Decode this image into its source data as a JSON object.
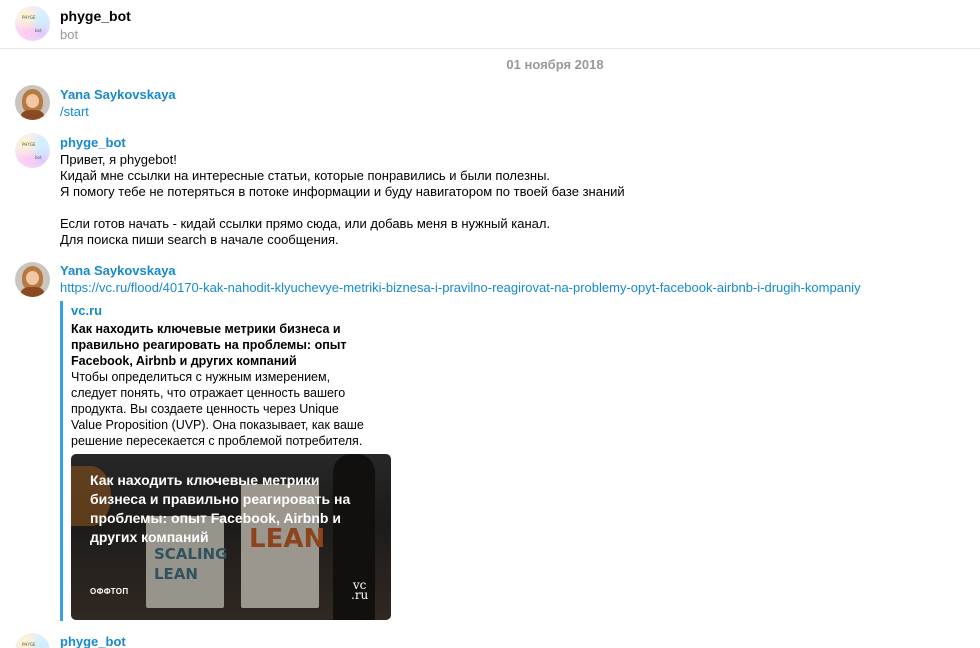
{
  "header": {
    "title": "phyge_bot",
    "subtitle": "bot",
    "avatar_text_top": "PHYGE",
    "avatar_text_bottom": "bot"
  },
  "date_separator": "01 ноября 2018",
  "messages": [
    {
      "author": "Yana Saykovskaya",
      "avatar": "user-photo",
      "text": "/start"
    },
    {
      "author": "phyge_bot",
      "avatar": "bot-logo",
      "lines": [
        "Привет, я phygebot!",
        "Кидай мне ссылки на интересные статьи, которые понравились и были полезны.",
        "Я помогу тебе не потеряться в потоке информации и буду навигатором по твоей базе знаний",
        "",
        "Если готов начать - кидай ссылки прямо сюда, или добавь меня в нужный канал.",
        "Для поиска пиши search в начале сообщения."
      ]
    },
    {
      "author": "Yana Saykovskaya",
      "avatar": "user-photo",
      "link": "https://vc.ru/flood/40170-kak-nahodit-klyuchevye-metriki-biznesa-i-pravilno-reagirovat-na-problemy-opyt-facebook-airbnb-i-drugih-kompaniy",
      "preview": {
        "site": "vc.ru",
        "title": "Как находить ключевые метрики бизнеса и\nправильно реагировать на проблемы: опыт\nFacebook, Airbnb и других компаний",
        "description": "Чтобы определиться с нужным измерением,\nследует понять, что отражает ценность вашего\nпродукта. Вы создаете ценность через Unique\nValue Proposition (UVP). Она показывает, как ваше\nрешение пересекается с проблемой потребителя.",
        "image": {
          "title": "Как находить ключевые метрики\nбизнеса и правильно реагировать на\nпроблемы: опыт Facebook, Airbnb и\nдругих компаний",
          "tag": "ОФФТОП",
          "logo_top": "vc",
          "logo_bottom": ".ru",
          "book1": "SCALING\nLEAN",
          "book2": "LEAN"
        }
      }
    },
    {
      "author": "phyge_bot",
      "avatar": "bot-logo"
    }
  ]
}
